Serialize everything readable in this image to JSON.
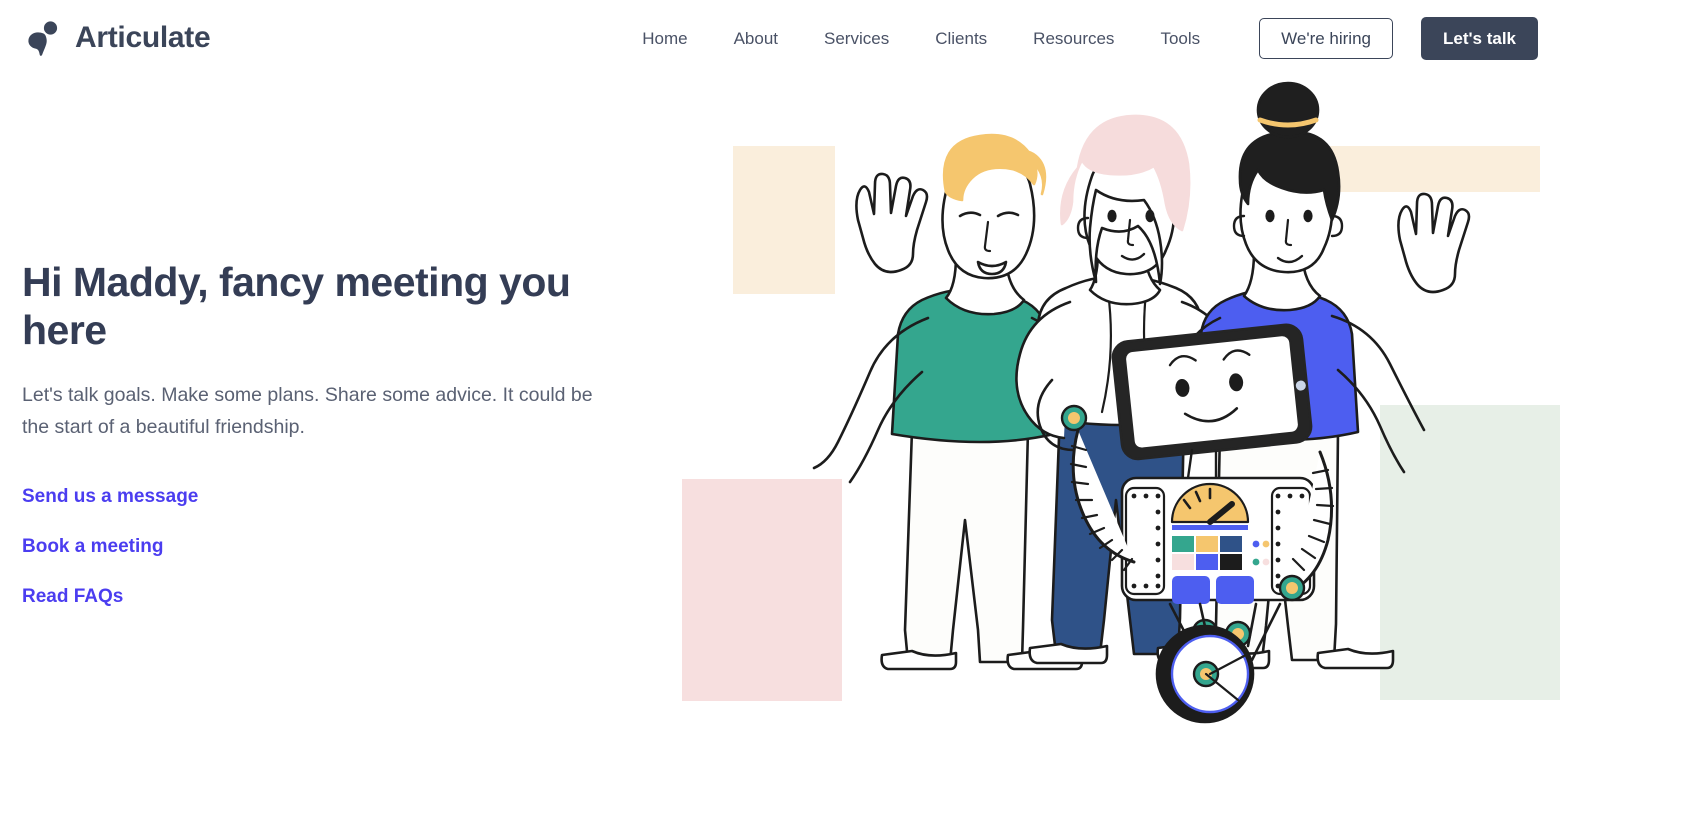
{
  "header": {
    "brand": {
      "name": "Articulate",
      "logo_icon": "articulate-bird-logo"
    },
    "nav_items": [
      {
        "label": "Home"
      },
      {
        "label": "About"
      },
      {
        "label": "Services"
      },
      {
        "label": "Clients"
      },
      {
        "label": "Resources"
      },
      {
        "label": "Tools"
      }
    ],
    "hiring_button": "We're hiring",
    "talk_button": "Let's talk"
  },
  "hero": {
    "title": "Hi Maddy, fancy meeting you here",
    "subtitle": "Let's talk goals. Make some plans. Share some advice. It could be the start of a beautiful friendship.",
    "links": [
      {
        "label": "Send us a message"
      },
      {
        "label": "Book a meeting"
      },
      {
        "label": "Read FAQs"
      }
    ]
  },
  "illustration": {
    "name": "three-people-waving-with-robot",
    "blocks": [
      {
        "name": "cream-block-left",
        "color": "#faeedc"
      },
      {
        "name": "cream-block-top-right",
        "color": "#faeedc"
      },
      {
        "name": "pink-block-left",
        "color": "#f7dfdf"
      },
      {
        "name": "green-block-right",
        "color": "#e7efe7"
      }
    ],
    "figures": [
      {
        "name": "person-green-shirt",
        "hair": "#f5c66e",
        "shirt": "#34a68e"
      },
      {
        "name": "person-white-top",
        "hair": "#f6dcdc",
        "shirt": "#ffffff"
      },
      {
        "name": "person-blue-shirt",
        "hair": "#1f1f1f",
        "shirt": "#4d5ef0"
      },
      {
        "name": "tablet-faced-robot",
        "screen": "#ffffff",
        "bezel": "#252525"
      }
    ]
  },
  "colors": {
    "ink": "#3b4559",
    "body_text": "#5a6173",
    "accent_link": "#4b3df0",
    "button_dark_bg": "#3b4559",
    "cream": "#faeedc",
    "pink": "#f7dfdf",
    "mint": "#e7efe7",
    "teal": "#34a68e",
    "blue": "#4d5ef0",
    "denim": "#2f5288",
    "gold": "#f5c66e"
  }
}
